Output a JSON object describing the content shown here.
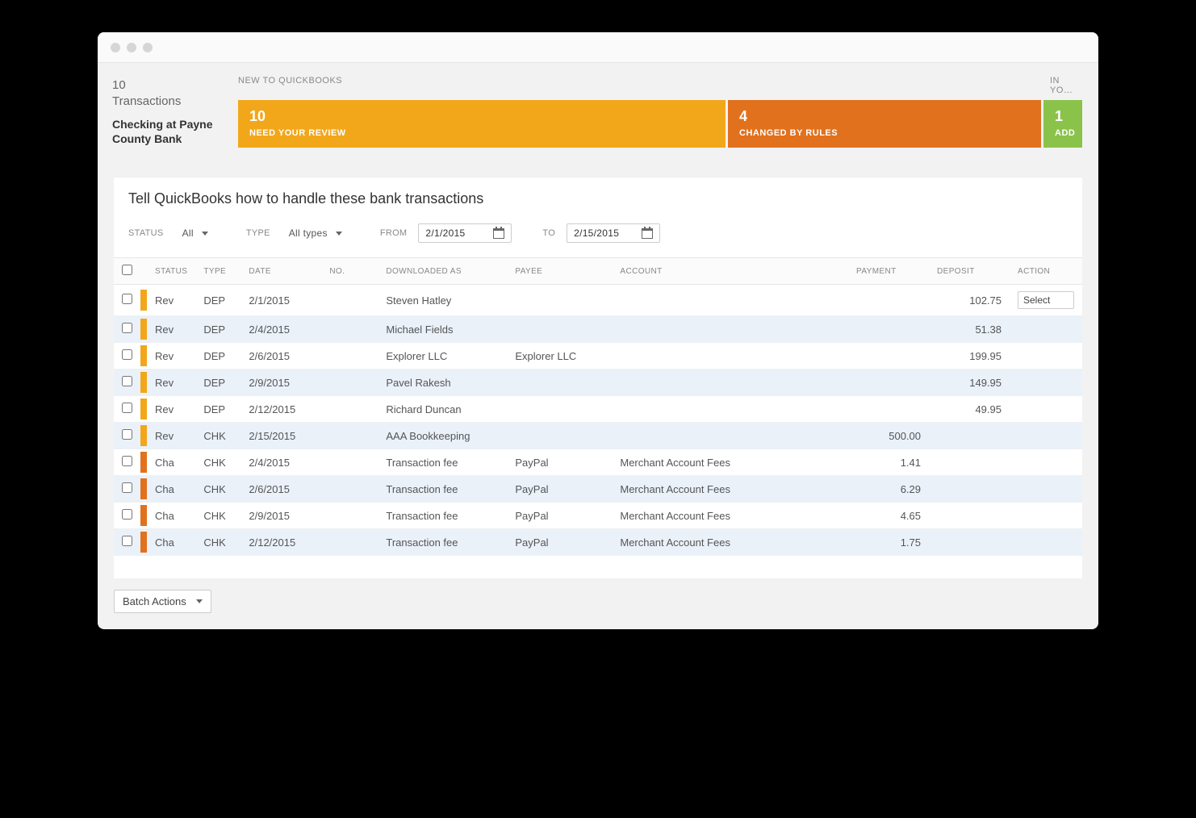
{
  "header": {
    "transaction_count": "10",
    "transaction_label": "Transactions",
    "account_name": "Checking at Payne County Bank",
    "section_new_label": "NEW TO QUICKBOOKS",
    "section_inyour_label": "IN YO…",
    "tabs": {
      "review": {
        "count": "10",
        "label": "NEED YOUR REVIEW"
      },
      "rules": {
        "count": "4",
        "label": "CHANGED BY RULES"
      },
      "add": {
        "count": "1",
        "label": "ADD"
      }
    }
  },
  "instruction": "Tell QuickBooks how to handle these bank transactions",
  "filters": {
    "status_label": "STATUS",
    "status_value": "All",
    "type_label": "TYPE",
    "type_value": "All types",
    "from_label": "FROM",
    "from_value": "2/1/2015",
    "to_label": "TO",
    "to_value": "2/15/2015"
  },
  "columns": {
    "status": "STATUS",
    "type": "TYPE",
    "date": "DATE",
    "no": "NO.",
    "downloaded_as": "DOWNLOADED AS",
    "payee": "PAYEE",
    "account": "ACCOUNT",
    "payment": "PAYMENT",
    "deposit": "DEPOSIT",
    "action": "ACTION"
  },
  "action_select_label": "Select",
  "rows": [
    {
      "bar": "y",
      "status": "Rev",
      "type": "DEP",
      "date": "2/1/2015",
      "no": "",
      "downloaded_as": "Steven Hatley",
      "payee": "",
      "account": "",
      "payment": "",
      "deposit": "102.75",
      "show_action": true
    },
    {
      "bar": "y",
      "status": "Rev",
      "type": "DEP",
      "date": "2/4/2015",
      "no": "",
      "downloaded_as": "Michael Fields",
      "payee": "",
      "account": "",
      "payment": "",
      "deposit": "51.38",
      "show_action": false
    },
    {
      "bar": "y",
      "status": "Rev",
      "type": "DEP",
      "date": "2/6/2015",
      "no": "",
      "downloaded_as": "Explorer LLC",
      "payee": "Explorer LLC",
      "account": "",
      "payment": "",
      "deposit": "199.95",
      "show_action": false
    },
    {
      "bar": "y",
      "status": "Rev",
      "type": "DEP",
      "date": "2/9/2015",
      "no": "",
      "downloaded_as": "Pavel Rakesh",
      "payee": "",
      "account": "",
      "payment": "",
      "deposit": "149.95",
      "show_action": false
    },
    {
      "bar": "y",
      "status": "Rev",
      "type": "DEP",
      "date": "2/12/2015",
      "no": "",
      "downloaded_as": "Richard Duncan",
      "payee": "",
      "account": "",
      "payment": "",
      "deposit": "49.95",
      "show_action": false
    },
    {
      "bar": "y",
      "status": "Rev",
      "type": "CHK",
      "date": "2/15/2015",
      "no": "",
      "downloaded_as": "AAA Bookkeeping",
      "payee": "",
      "account": "",
      "payment": "500.00",
      "deposit": "",
      "show_action": false
    },
    {
      "bar": "o",
      "status": "Cha",
      "type": "CHK",
      "date": "2/4/2015",
      "no": "",
      "downloaded_as": "Transaction fee",
      "payee": "PayPal",
      "account": "Merchant Account Fees",
      "payment": "1.41",
      "deposit": "",
      "show_action": false
    },
    {
      "bar": "o",
      "status": "Cha",
      "type": "CHK",
      "date": "2/6/2015",
      "no": "",
      "downloaded_as": "Transaction fee",
      "payee": "PayPal",
      "account": "Merchant Account Fees",
      "payment": "6.29",
      "deposit": "",
      "show_action": false
    },
    {
      "bar": "o",
      "status": "Cha",
      "type": "CHK",
      "date": "2/9/2015",
      "no": "",
      "downloaded_as": "Transaction fee",
      "payee": "PayPal",
      "account": "Merchant Account Fees",
      "payment": "4.65",
      "deposit": "",
      "show_action": false
    },
    {
      "bar": "o",
      "status": "Cha",
      "type": "CHK",
      "date": "2/12/2015",
      "no": "",
      "downloaded_as": "Transaction fee",
      "payee": "PayPal",
      "account": "Merchant Account Fees",
      "payment": "1.75",
      "deposit": "",
      "show_action": false
    }
  ],
  "footer": {
    "batch_label": "Batch Actions"
  }
}
